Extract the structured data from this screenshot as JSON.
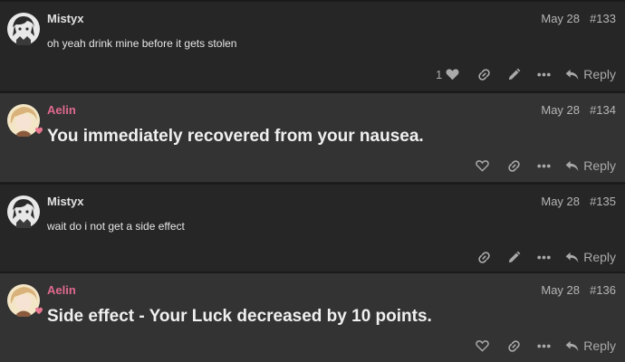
{
  "posts": [
    {
      "author": "Mistyx",
      "author_style": "mistyx",
      "date": "May 28",
      "number": "#133",
      "body": "oh yeah drink mine before it gets stolen",
      "body_style": "small",
      "like_count": "1",
      "liked": true,
      "has_edit": true,
      "reply_label": "Reply"
    },
    {
      "author": "Aelin",
      "author_style": "aelin",
      "date": "May 28",
      "number": "#134",
      "body": "You immediately recovered from your nausea.",
      "body_style": "large",
      "like_count": "",
      "liked": false,
      "has_edit": false,
      "reply_label": "Reply"
    },
    {
      "author": "Mistyx",
      "author_style": "mistyx",
      "date": "May 28",
      "number": "#135",
      "body": "wait do i not get a side effect",
      "body_style": "small",
      "like_count": "",
      "liked": false,
      "has_edit": true,
      "reply_label": "Reply"
    },
    {
      "author": "Aelin",
      "author_style": "aelin",
      "date": "May 28",
      "number": "#136",
      "body": "Side effect - Your Luck decreased by 10 points.",
      "body_style": "large",
      "like_count": "",
      "liked": false,
      "has_edit": false,
      "reply_label": "Reply"
    }
  ],
  "icons": {
    "like": "heart-icon",
    "link": "link-icon",
    "edit": "pencil-icon",
    "more": "ellipsis-icon",
    "reply": "reply-arrow-icon"
  },
  "colors": {
    "aelin_name": "#e06a8e",
    "mistyx_name": "#e2e2e2",
    "post_dark_bg": "#262626",
    "post_light_bg": "#333333"
  }
}
